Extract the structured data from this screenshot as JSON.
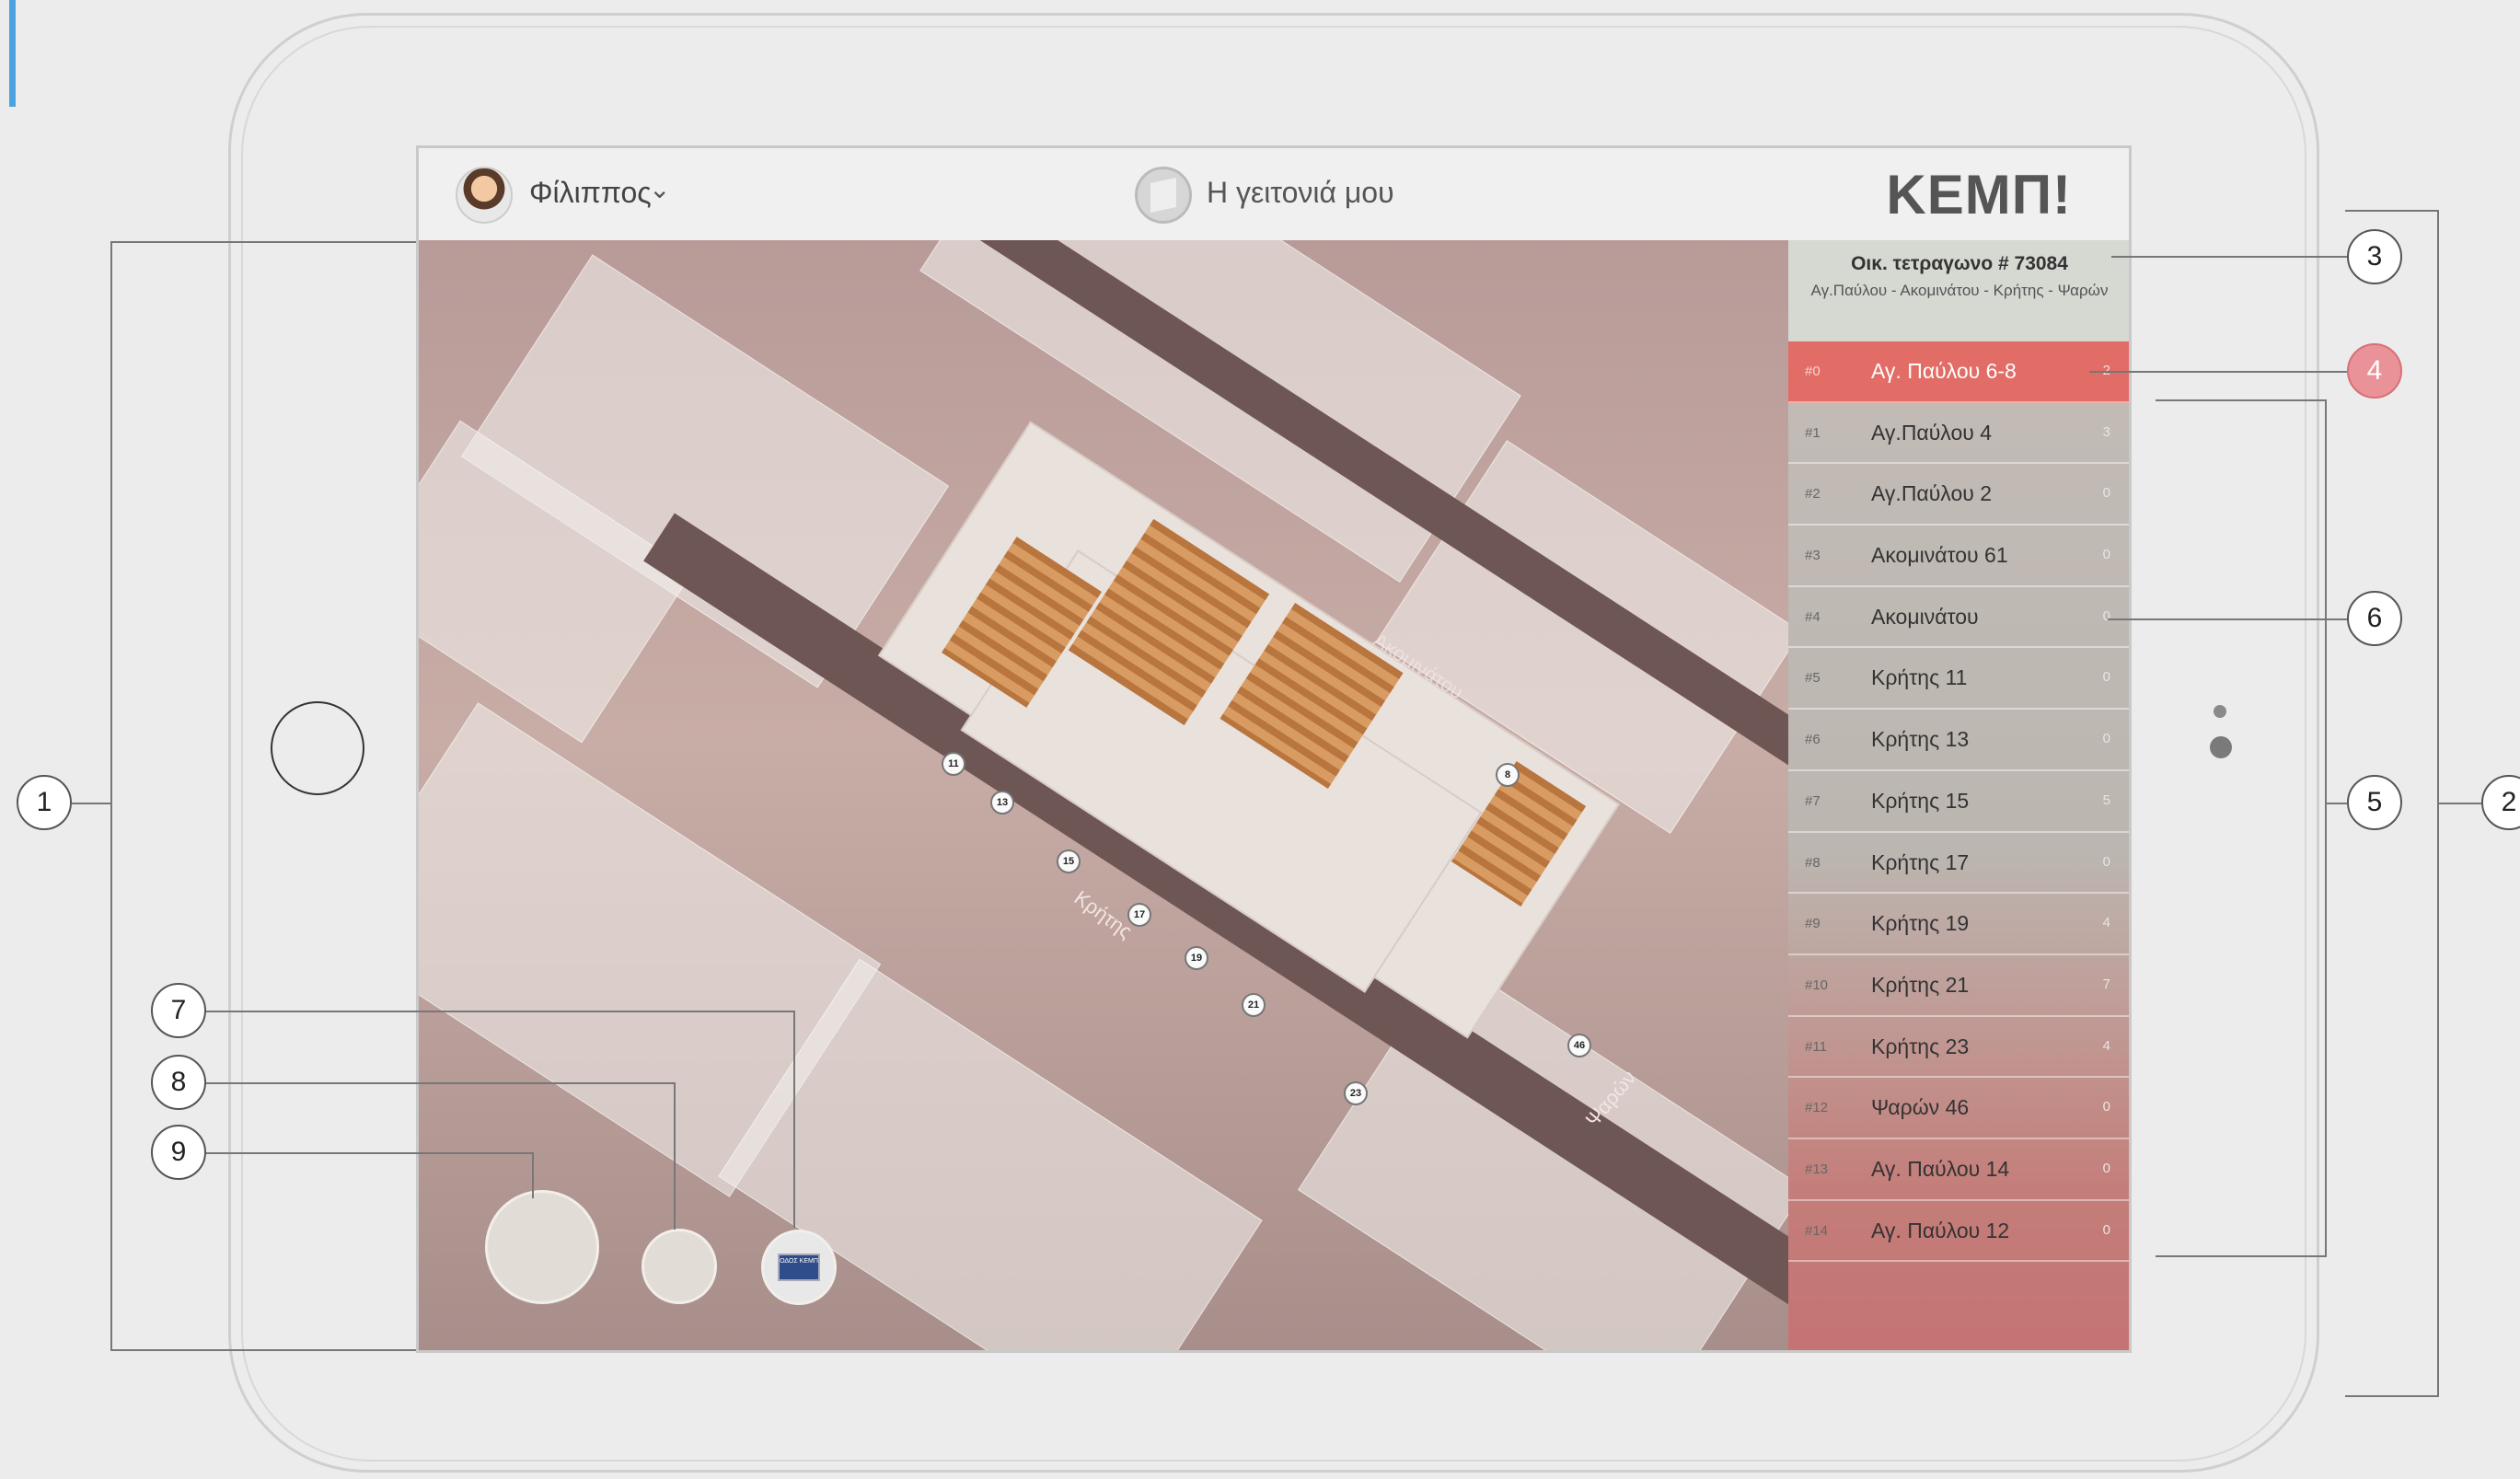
{
  "header": {
    "user_name": "Φίλιππος",
    "neighborhood_title": "Η γειτονιά μου",
    "logo": "ΚΕΜΠ!"
  },
  "block": {
    "title": "Οικ. τετραγωνο # 73084",
    "streets": "Αγ.Παύλου - Ακομινάτου - Κρήτης - Ψαρών"
  },
  "buildings": [
    {
      "id": "#0",
      "name": "Αγ. Παύλου 6-8",
      "count": "2",
      "active": true
    },
    {
      "id": "#1",
      "name": "Αγ.Παύλου 4",
      "count": "3"
    },
    {
      "id": "#2",
      "name": "Αγ.Παύλου 2",
      "count": "0"
    },
    {
      "id": "#3",
      "name": "Ακομινάτου 61",
      "count": "0"
    },
    {
      "id": "#4",
      "name": "Ακομινάτου",
      "count": "0"
    },
    {
      "id": "#5",
      "name": "Κρήτης 11",
      "count": "0"
    },
    {
      "id": "#6",
      "name": "Κρήτης 13",
      "count": "0"
    },
    {
      "id": "#7",
      "name": "Κρήτης 15",
      "count": "5"
    },
    {
      "id": "#8",
      "name": "Κρήτης 17",
      "count": "0"
    },
    {
      "id": "#9",
      "name": "Κρήτης 19",
      "count": "4"
    },
    {
      "id": "#10",
      "name": "Κρήτης 21",
      "count": "7"
    },
    {
      "id": "#11",
      "name": "Κρήτης 23",
      "count": "4"
    },
    {
      "id": "#12",
      "name": "Ψαρών 46",
      "count": "0"
    },
    {
      "id": "#13",
      "name": "Αγ. Παύλου 14",
      "count": "0"
    },
    {
      "id": "#14",
      "name": "Αγ. Παύλου 12",
      "count": "0"
    }
  ],
  "map": {
    "street_labels": [
      "Κρήτης",
      "Ψαρών",
      "Ακομινάτου"
    ],
    "number_markers": [
      "11",
      "13",
      "15",
      "17",
      "19",
      "21",
      "23",
      "46",
      "8"
    ],
    "sign_button_text": "ΟΔΟΣ ΚΕΜΠ"
  },
  "callouts": [
    "1",
    "2",
    "3",
    "4",
    "5",
    "6",
    "7",
    "8",
    "9"
  ],
  "colors": {
    "active_row": "#e26c66",
    "accent_bar": "#4aa3df",
    "highlight_callout": "#e99297"
  }
}
